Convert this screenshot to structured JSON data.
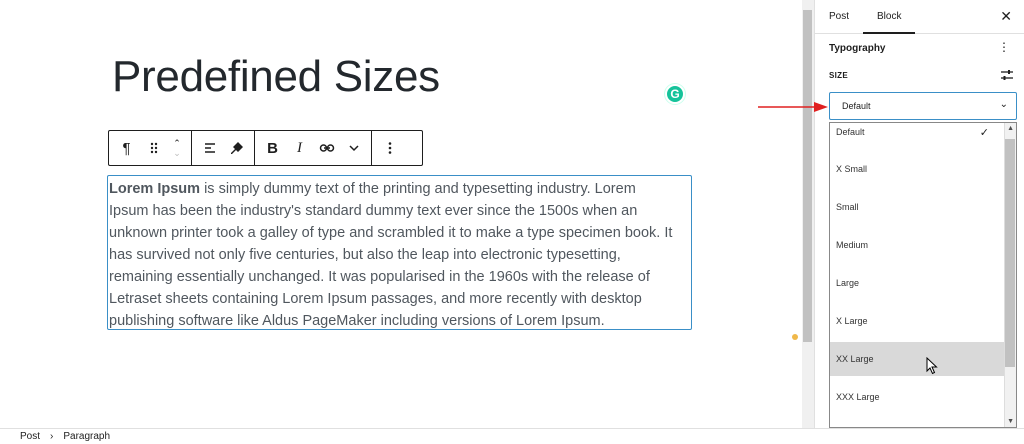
{
  "editor": {
    "title": "Predefined Sizes",
    "grammarly_badge": "G",
    "toolbar": {
      "paragraph_icon": "paragraph-icon",
      "buttons": [
        "¶",
        "Bold",
        "Italic",
        "Link",
        "More options"
      ]
    },
    "paragraph": {
      "bold_lead": "Lorem Ipsum",
      "rest": " is simply dummy text of the printing and typesetting industry. Lorem Ipsum has been the industry's standard dummy text ever since the 1500s when an unknown printer took a galley of type and scrambled it to make a type specimen book. It has survived not only five centuries, but also the leap into electronic typesetting, remaining essentially unchanged. It was popularised in the 1960s with the release of Letraset sheets containing Lorem Ipsum passages, and more recently with desktop publishing software like Aldus PageMaker including versions of Lorem Ipsum."
    }
  },
  "sidebar": {
    "tabs": [
      "Post",
      "Block"
    ],
    "active_tab": "Block",
    "panel_title": "Typography",
    "size_label": "SIZE",
    "select_value": "Default",
    "options": [
      "Default",
      "X Small",
      "Small",
      "Medium",
      "Large",
      "X Large",
      "XX Large",
      "XXX Large"
    ],
    "selected_option": "Default",
    "hovered_option": "XX Large"
  },
  "breadcrumb": {
    "items": [
      "Post",
      "Paragraph"
    ]
  },
  "colors": {
    "accent": "#3a8fc7",
    "annotation_arrow": "#e02020",
    "hover": "#d9d9d9"
  }
}
